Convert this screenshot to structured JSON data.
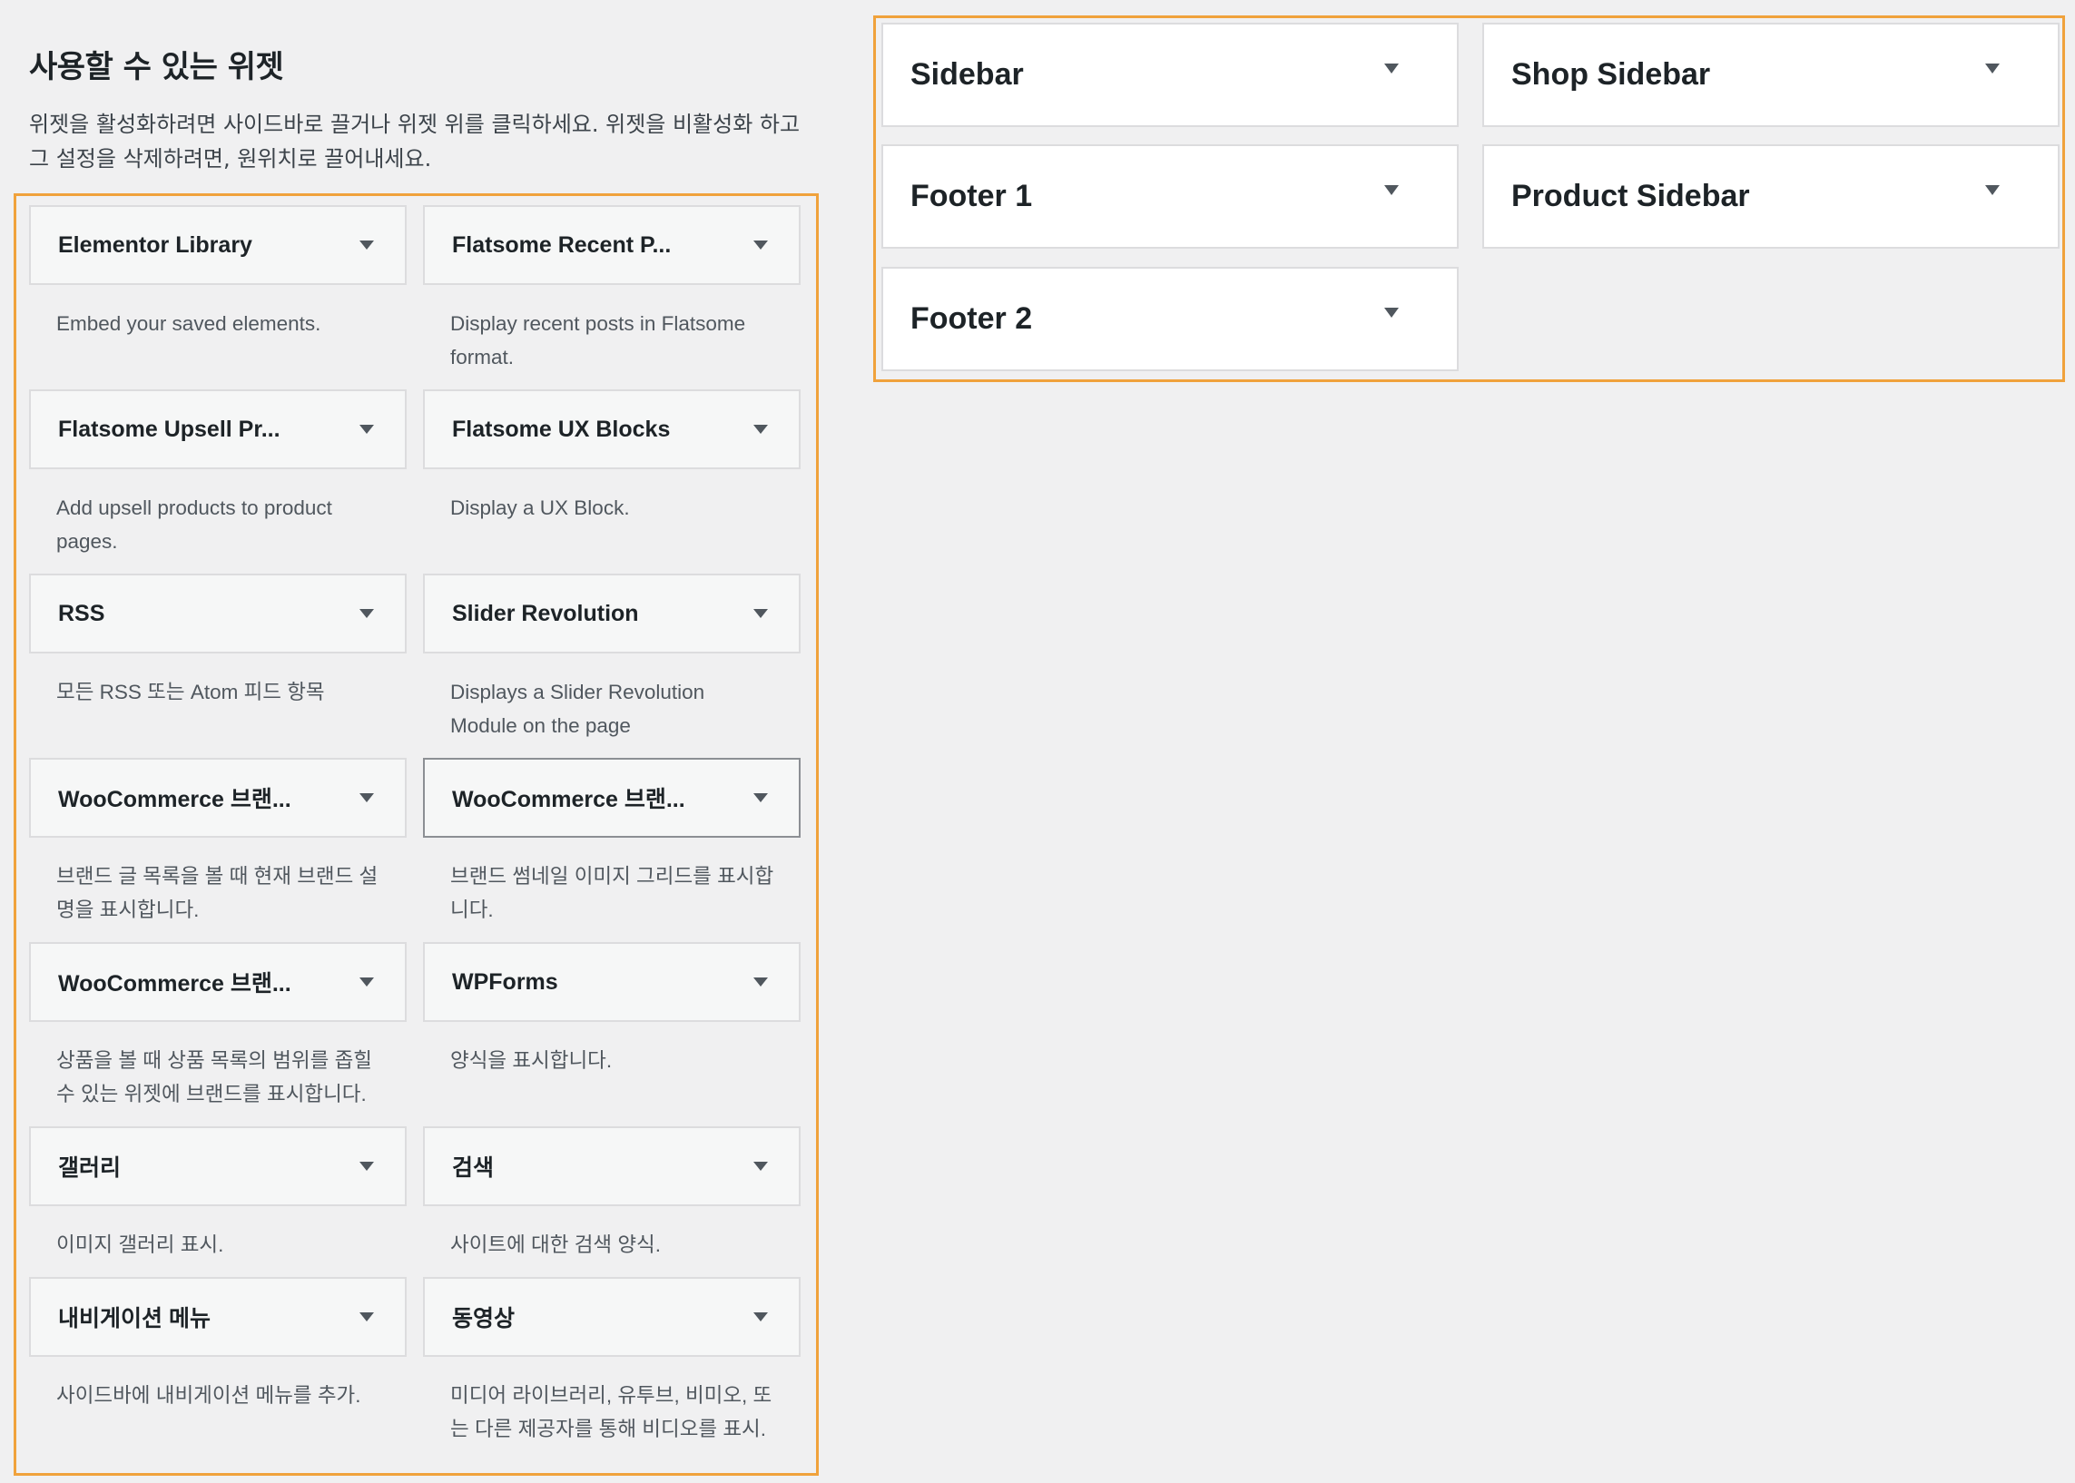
{
  "available": {
    "title": "사용할 수 있는 위젯",
    "description": "위젯을 활성화하려면 사이드바로 끌거나 위젯 위를 클릭하세요. 위젯을 비활성화 하고 그 설정을 삭제하려면, 원위치로 끌어내세요."
  },
  "widgets": [
    {
      "title": "Elementor Library",
      "description": "Embed your saved elements."
    },
    {
      "title": "Flatsome Recent P...",
      "description": "Display recent posts in Flatsome format."
    },
    {
      "title": "Flatsome Upsell Pr...",
      "description": "Add upsell products to product pages."
    },
    {
      "title": "Flatsome UX Blocks",
      "description": "Display a UX Block."
    },
    {
      "title": "RSS",
      "description": "모든 RSS 또는 Atom 피드 항목"
    },
    {
      "title": "Slider Revolution",
      "description": "Displays a Slider Revolution Module on the page"
    },
    {
      "title": "WooCommerce 브랜...",
      "description": "브랜드 글 목록을 볼 때 현재 브랜드 설명을 표시합니다."
    },
    {
      "title": "WooCommerce 브랜...",
      "description": "브랜드 썸네일 이미지 그리드를 표시합니다."
    },
    {
      "title": "WooCommerce 브랜...",
      "description": "상품을 볼 때 상품 목록의 범위를 좁힐 수 있는 위젯에 브랜드를 표시합니다."
    },
    {
      "title": "WPForms",
      "description": "양식을 표시합니다."
    },
    {
      "title": "갤러리",
      "description": "이미지 갤러리 표시."
    },
    {
      "title": "검색",
      "description": "사이트에 대한 검색 양식."
    },
    {
      "title": "내비게이션 메뉴",
      "description": "사이드바에 내비게이션 메뉴를 추가."
    },
    {
      "title": "동영상",
      "description": "미디어 라이브러리, 유투브, 비미오, 또는 다른 제공자를 통해 비디오를 표시."
    }
  ],
  "sidebars": [
    {
      "title": "Sidebar"
    },
    {
      "title": "Shop Sidebar"
    },
    {
      "title": "Footer 1"
    },
    {
      "title": "Product Sidebar"
    },
    {
      "title": "Footer 2"
    }
  ],
  "colors": {
    "highlight_border": "#f0a23c",
    "background": "#f0f0f1",
    "widget_bg": "#f6f7f7",
    "panel_bg": "#ffffff"
  },
  "icons": {
    "toggle": "caret-down-icon"
  }
}
